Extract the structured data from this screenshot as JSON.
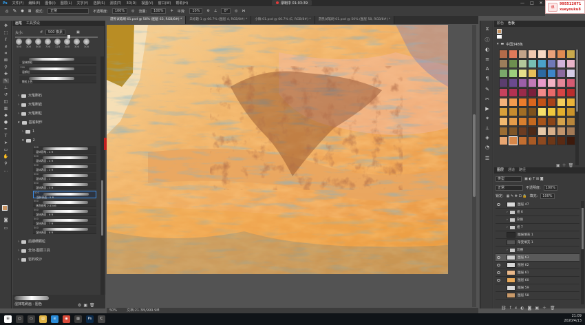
{
  "menu": [
    "文件(F)",
    "编辑(E)",
    "图像(I)",
    "图层(L)",
    "文字(Y)",
    "选择(S)",
    "滤镜(T)",
    "3D(D)",
    "视图(V)",
    "窗口(W)",
    "帮助(H)"
  ],
  "recorder": {
    "label": "录制中 01:03:39"
  },
  "window_controls": [
    "—",
    "□",
    "✕"
  ],
  "badge": {
    "line1": "995512071",
    "line2": "xueyouku8",
    "logo": "课"
  },
  "options": {
    "mode_label": "模式:",
    "mode_value": "正常",
    "opacity_label": "不透明度:",
    "opacity_value": "100%",
    "flow_label": "流量:",
    "flow_value": "100%",
    "smooth_label": "平滑:",
    "smooth_value": "10%",
    "angle_value": "0°"
  },
  "tabs": [
    {
      "label": "游民试笔刷-01.psd @ 50% (图层 63, RGB/8#) *",
      "active": true
    },
    {
      "label": "未标题-1 @ 66.7% (图层 4, RGB/8#) *",
      "active": false
    },
    {
      "label": "小稿-01.psd @ 66.7% (E, RGB/8#) *",
      "active": false
    },
    {
      "label": "游民试笔刷-01.psd @ 50% (图层 58, RGB/8#) *",
      "active": false
    }
  ],
  "brush_panel": {
    "tabs": [
      "画笔",
      "工具预设"
    ],
    "size_label": "大小:",
    "size_value": "500 像素",
    "presets": [
      {
        "n": "500"
      },
      {
        "n": "300"
      },
      {
        "n": "300"
      },
      {
        "n": "700"
      },
      {
        "n": "125"
      },
      {
        "n": "280"
      },
      {
        "n": "300"
      },
      {
        "n": "300"
      }
    ],
    "top_items": [
      {
        "num": "",
        "label": "湿抹颜粒"
      },
      {
        "num": "128",
        "label": "湿颜粒"
      },
      {
        "num": "",
        "label": "颗粒上色"
      }
    ],
    "folders": [
      {
        "label": "大笔刷石"
      },
      {
        "label": "大笔刷岩"
      },
      {
        "label": "大笔刷粒"
      },
      {
        "label": "基底制作"
      }
    ],
    "subfolders": [
      {
        "label": "1"
      },
      {
        "label": "2"
      }
    ],
    "items": [
      {
        "num": "500",
        "label": "湿抹画笔 - 4 R"
      },
      {
        "num": "500",
        "label": "湿抹表面 - 4 R"
      },
      {
        "num": "500",
        "label": "湿抹表面 - 2 R"
      },
      {
        "num": "500",
        "label": "湿抹表面 - 1"
      },
      {
        "num": "500",
        "label": "湿抹表面 - 3 R"
      },
      {
        "num": "500",
        "label": "湿抹表面 - 5 R"
      },
      {
        "num": "500",
        "label": "抹底画笔 2.4346"
      },
      {
        "num": "500",
        "label": "湿抹表面 - 6 R"
      },
      {
        "num": "500",
        "label": "湿抹表面 - 7 R"
      },
      {
        "num": "500",
        "label": "湿抹表面 - 8 R"
      }
    ],
    "bottom_folders": [
      {
        "label": "后期细颗粒"
      },
      {
        "label": "全功-图层工具"
      },
      {
        "label": "岩石纹沙"
      }
    ],
    "footer_label": "湿抹笔刷画 - 图色"
  },
  "status": {
    "zoom": "50%",
    "doc": "文档:21.3M/999.9M"
  },
  "right_dock": {
    "swatch_tabs": [
      "颜色",
      "色板"
    ],
    "swatch_group": "中国348色",
    "swatches": [
      "#b36b4a",
      "#e07a5a",
      "#c2a389",
      "#f0c9b0",
      "#f7d9c4",
      "#e9a27a",
      "#df8b52",
      "#c9a94c",
      "#9c7d5b",
      "#6d8f4f",
      "#b3c79a",
      "#77bfb3",
      "#4aa2c9",
      "#6f78b7",
      "#d1b2da",
      "#e9b5c9",
      "#7aa86a",
      "#9ccf7d",
      "#e5e08a",
      "#e6c15a",
      "#2c6aa3",
      "#3d86c8",
      "#8a6a9e",
      "#d6cde6",
      "#5b3e6e",
      "#6b4a8f",
      "#9b5fa8",
      "#c27ab8",
      "#e89acb",
      "#f2b3c4",
      "#e48798",
      "#d45a72",
      "#c7425d",
      "#b33152",
      "#9a2b4a",
      "#7b1f3c",
      "#f28a8a",
      "#e86a6a",
      "#d64545",
      "#b82d2d",
      "#f4b27a",
      "#f19b4f",
      "#ea7c2c",
      "#d9661e",
      "#c25318",
      "#a8431a",
      "#f2cc5a",
      "#e9b338",
      "#d8a03a",
      "#c58b2f",
      "#a06d25",
      "#7d521d",
      "#f6e06a",
      "#efc83d",
      "#e2ae2c",
      "#c9932a",
      "#f1b96f",
      "#e49c4a",
      "#d77f2f",
      "#c4691f",
      "#a7541a",
      "#8a4518",
      "#d4a24a",
      "#b8863b",
      "#9b6d33",
      "#7d5528",
      "#6b3c22",
      "#4c2a18",
      "#e6c9a8",
      "#d8b08a",
      "#c2956c",
      "#a37a56",
      "#e8a672",
      "#d6874a",
      "#c26e31",
      "#a85a25",
      "#8d4920",
      "#6d3717",
      "#5a2a13",
      "#3d1a0c"
    ],
    "layer_tabs": [
      "图层",
      "通道",
      "路径"
    ],
    "layer_filter": "类型",
    "blend": "正常",
    "opacity_label": "不透明度:",
    "opacity": "100%",
    "lock_label": "锁定:",
    "fill_label": "填充:",
    "fill": "100%",
    "layers": [
      {
        "label": "图层 47",
        "vis": true,
        "thumb": "#d9d9d9",
        "sel": false,
        "icon": ""
      },
      {
        "label": "组 6",
        "vis": false,
        "thumb": "",
        "sel": false,
        "icon": "folder"
      },
      {
        "label": "杂质",
        "vis": false,
        "thumb": "",
        "sel": false,
        "icon": "folder"
      },
      {
        "label": "组 7",
        "vis": false,
        "thumb": "",
        "sel": false,
        "icon": "folder"
      },
      {
        "label": "图层填充 1",
        "vis": false,
        "thumb": "#2b2b2b",
        "sel": false,
        "icon": ""
      },
      {
        "label": "渐变填充 1",
        "vis": false,
        "thumb": "#555",
        "sel": false,
        "icon": ""
      },
      {
        "label": "切撞",
        "vis": false,
        "thumb": "",
        "sel": false,
        "icon": "folder"
      },
      {
        "label": "图层 63",
        "vis": true,
        "thumb": "#cfcfcf",
        "sel": true,
        "icon": ""
      },
      {
        "label": "图层 62",
        "vis": true,
        "thumb": "#d8d8d8",
        "sel": false,
        "icon": ""
      },
      {
        "label": "图层 61",
        "vis": true,
        "thumb": "#e9b88a",
        "sel": false,
        "icon": ""
      },
      {
        "label": "图层 60",
        "vis": true,
        "thumb": "#e8a95a",
        "sel": false,
        "icon": ""
      },
      {
        "label": "图层 59",
        "vis": false,
        "thumb": "#d9d9d9",
        "sel": false,
        "icon": ""
      },
      {
        "label": "图层 58",
        "vis": false,
        "thumb": "#c99a6a",
        "sel": false,
        "icon": ""
      }
    ]
  },
  "taskbar": {
    "icons": [
      {
        "name": "windows-icon",
        "c": "#ffffff",
        "t": "⊞"
      },
      {
        "name": "search-icon",
        "c": "#3c3c3c",
        "t": "○"
      },
      {
        "name": "taskview-icon",
        "c": "#3c3c3c",
        "t": "▭"
      },
      {
        "name": "folder-icon",
        "c": "#e1b445",
        "t": "▤"
      },
      {
        "name": "edge-icon",
        "c": "#2a8bd8",
        "t": "e"
      },
      {
        "name": "chrome-icon",
        "c": "#d94b3a",
        "t": "◉"
      },
      {
        "name": "app1-icon",
        "c": "#3a3a3a",
        "t": "▥"
      },
      {
        "name": "photoshop-icon",
        "c": "#0b2a4a",
        "t": "Ps"
      },
      {
        "name": "app2-icon",
        "c": "#444",
        "t": "C"
      }
    ],
    "time": "21:09",
    "date": "2020/4/13"
  }
}
